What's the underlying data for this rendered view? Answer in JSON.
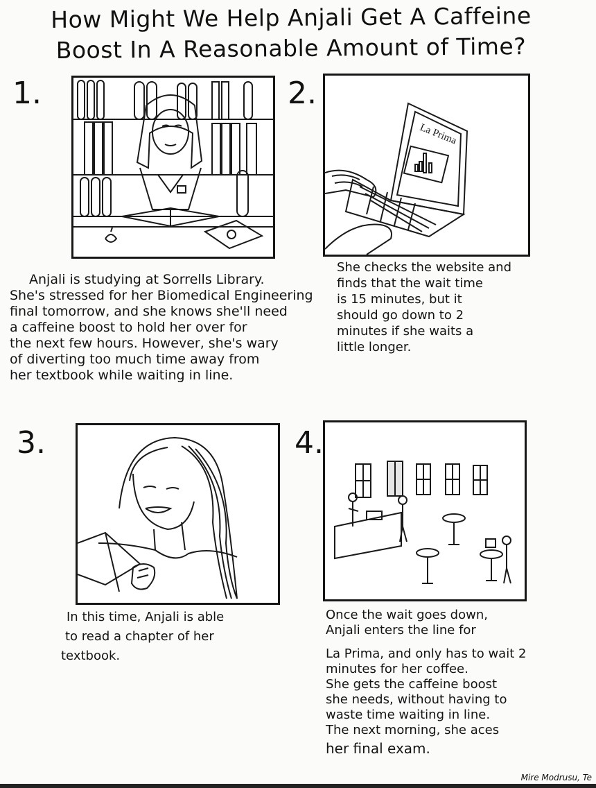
{
  "title": {
    "line1": "How Might We Help Anjali Get A Caffeine",
    "line2": "Boost In A Reasonable Amount of Time?"
  },
  "panels": [
    {
      "number": "1.",
      "caption": [
        "Anjali is studying at Sorrells Library.",
        "She's stressed for her Biomedical Engineering",
        "final tomorrow, and she knows she'll need",
        "a caffeine boost to hold her over for",
        "the next few hours. However, she's wary",
        "of diverting too much time away from",
        "her textbook while waiting in line."
      ]
    },
    {
      "number": "2.",
      "screen_text": "La Prima",
      "caption": [
        "She checks the website and",
        "finds that the wait time",
        "is 15 minutes, but it",
        "should go down to 2",
        "minutes if she waits a",
        "little longer."
      ]
    },
    {
      "number": "3.",
      "caption": [
        "In this time, Anjali is able",
        "to read a chapter of her",
        "textbook."
      ]
    },
    {
      "number": "4.",
      "caption": [
        "Once the wait goes down,",
        "Anjali enters the line for",
        "La Prima, and only has to wait 2",
        "minutes for her coffee.",
        "She gets the caffeine boost",
        "she needs, without having to",
        "waste time waiting in line.",
        "The next morning, she aces",
        "her final exam."
      ]
    }
  ],
  "signature": "Mire Modrusu, Te"
}
